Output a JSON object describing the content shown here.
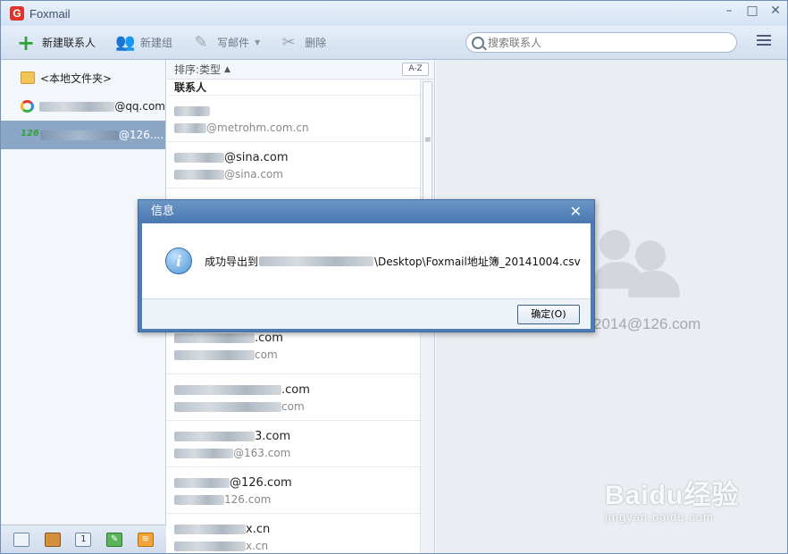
{
  "titlebar": {
    "title": "Foxmail",
    "logo_letter": "G"
  },
  "toolbar": {
    "new_contact": "新建联系人",
    "new_group": "新建组",
    "write_mail": "写邮件",
    "delete": "删除",
    "search_placeholder": "搜索联系人"
  },
  "sidebar": {
    "items": [
      {
        "label": "<本地文件夹>"
      },
      {
        "label_suffix": "@qq.com"
      },
      {
        "label_suffix": "@126...."
      }
    ]
  },
  "contacts": {
    "sort_label": "排序:类型",
    "az_label": "A-Z",
    "group_label": "联系人",
    "rows": [
      {
        "line1_suffix": "",
        "line2_suffix": "@metrohm.com.cn"
      },
      {
        "line1_suffix": "@sina.com",
        "line2_suffix": "@sina.com"
      },
      {
        "line1_suffix": ".com",
        "line2_suffix": "com"
      },
      {
        "line1_suffix": ".com",
        "line2_suffix": "com"
      },
      {
        "line1_suffix": "3.com",
        "line2_suffix": "@163.com"
      },
      {
        "line1_suffix": "@126.com",
        "line2_suffix": "126.com"
      },
      {
        "line1_suffix": "x.cn",
        "line2_suffix": "x.cn"
      }
    ]
  },
  "detail": {
    "email_suffix": "2014@126.com"
  },
  "dialog": {
    "title": "信息",
    "message_prefix": "成功导出到",
    "message_suffix": "\\Desktop\\Foxmail地址簿_20141004.csv",
    "ok_label": "确定(O)"
  },
  "watermark": {
    "top": "Baidu经验",
    "bottom": "jingyan.baidu.com"
  }
}
